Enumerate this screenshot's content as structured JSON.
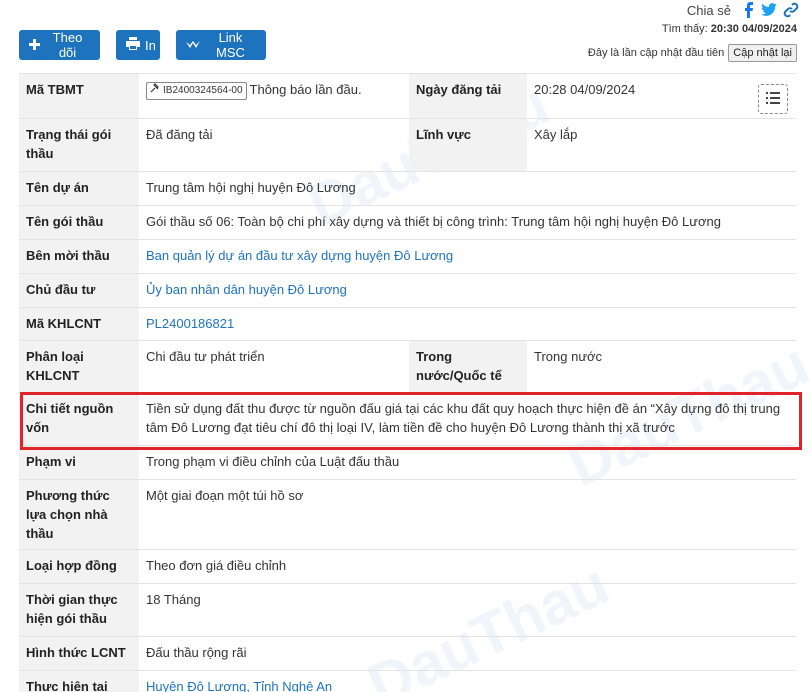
{
  "share": {
    "label": "Chia sẻ",
    "icons": [
      "facebook-icon",
      "twitter-icon",
      "link-icon"
    ]
  },
  "found": {
    "label": "Tìm thấy:",
    "time": "20:30 04/09/2024"
  },
  "update": {
    "note": "Đây là lần cập nhật đầu tiên",
    "button": "Cập nhật lại"
  },
  "toolbar": {
    "follow": "Theo dõi",
    "print": "In",
    "msc": "Link MSC"
  },
  "colors": {
    "primary": "#1e73be",
    "highlight": "#e0242a",
    "label_bg": "#f2f2f2"
  },
  "rows": {
    "tbmt": {
      "label": "Mã TBMT",
      "code": "IB2400324564-00",
      "note": "Thông báo lần đầu.",
      "date_label": "Ngày đăng tải",
      "date_value": "20:28 04/09/2024"
    },
    "status": {
      "label": "Trạng thái gói thầu",
      "value": "Đã đăng tải",
      "field_label": "Lĩnh vực",
      "field_value": "Xây lắp"
    },
    "project": {
      "label": "Tên dự án",
      "value": "Trung tâm hội nghị huyện Đô Lương"
    },
    "package": {
      "label": "Tên gói thầu",
      "value": "Gói thầu số 06: Toàn bộ chi phí xây dựng và thiết bị công trình: Trung tâm hội nghị huyện Đô Lương"
    },
    "inviter": {
      "label": "Bên mời thầu",
      "value": "Ban quản lý dự án đầu tư xây dựng huyện Đô Lương"
    },
    "investor": {
      "label": "Chủ đầu tư",
      "value": "Ủy ban nhân dân huyện Đô Lương"
    },
    "khlcnt": {
      "label": "Mã KHLCNT",
      "value": "PL2400186821"
    },
    "classify": {
      "label": "Phân loại KHLCNT",
      "value": "Chi đầu tư phát triển",
      "domestic_label": "Trong nước/Quốc tế",
      "domestic_value": "Trong nước"
    },
    "funding": {
      "label": "Chi tiết nguồn vốn",
      "value": "Tiền sử dụng đất thu được từ nguồn đấu giá tại các khu đất quy hoạch thực hiện đề án “Xây dựng đô thị trung tâm Đô Lương đạt tiêu chí đô thị loại IV, làm tiền đề cho huyện Đô Lương thành thị xã trước"
    },
    "scope": {
      "label": "Phạm vi",
      "value": "Trong phạm vi điều chỉnh của Luật đấu thầu"
    },
    "method": {
      "label": "Phương thức lựa chọn nhà thầu",
      "value": "Một giai đoạn một túi hồ sơ"
    },
    "contract": {
      "label": "Loại hợp đồng",
      "value": "Theo đơn giá điều chỉnh"
    },
    "duration": {
      "label": "Thời gian thực hiện gói thầu",
      "value": "18 Tháng"
    },
    "form": {
      "label": "Hình thức LCNT",
      "value": "Đấu thầu rộng rãi"
    },
    "location": {
      "label": "Thực hiện tại",
      "value": "Huyện Đô Lương, Tỉnh Nghệ An"
    }
  }
}
